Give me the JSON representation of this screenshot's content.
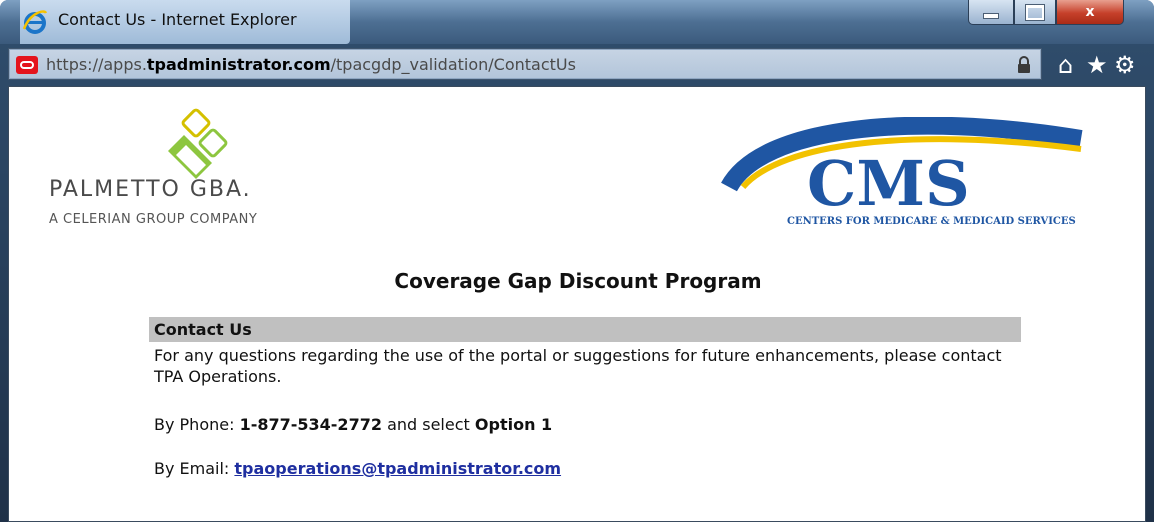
{
  "window": {
    "title": "Contact Us - Internet Explorer",
    "controls": {
      "minimize_icon": "minimize-icon",
      "maximize_icon": "maximize-icon",
      "close_label": "x"
    }
  },
  "addressbar": {
    "protocol": "https://",
    "subdomain": "apps.",
    "host": "tpadministrator.com",
    "path": "/tpacgdp_validation/ContactUs"
  },
  "toolbar": {
    "icons": [
      "home-icon",
      "favorites-star-icon",
      "tools-gear-icon"
    ]
  },
  "logos": {
    "palmetto_name": "PALMETTO GBA.",
    "palmetto_tagline": "A CELERIAN GROUP COMPANY",
    "cms_text": "CMS",
    "cms_subtitle": "CENTERS FOR MEDICARE & MEDICAID SERVICES"
  },
  "page": {
    "title": "Coverage Gap Discount Program",
    "section_header": "Contact Us",
    "intro": "For any questions regarding the use of the portal or suggestions for future enhancements, please contact TPA Operations.",
    "phone_label": "By Phone:",
    "phone_number": "1-877-534-2772",
    "phone_mid": "and select",
    "phone_option": "Option 1",
    "email_label": "By Email:",
    "email": "tpaoperations@tpadministrator.com"
  },
  "colors": {
    "window_frame": "#2f4c6b",
    "section_header_bg": "#c0c0c0",
    "link": "#1f2fa0",
    "cms_blue": "#1f56a3",
    "cms_yellow": "#f2c200",
    "palmetto_green": "#8dc63f"
  }
}
